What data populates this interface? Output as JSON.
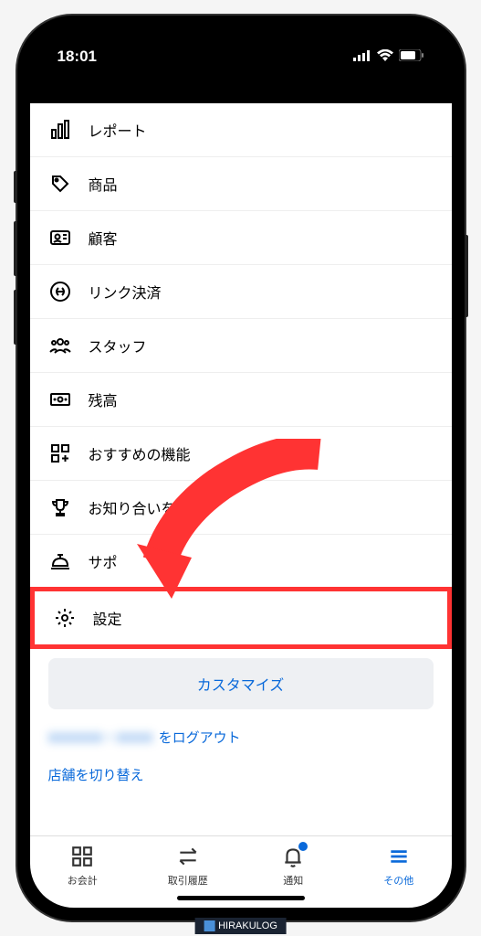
{
  "status_bar": {
    "time": "18:01"
  },
  "menu": {
    "items": [
      {
        "id": "reports",
        "label": "レポート"
      },
      {
        "id": "items",
        "label": "商品"
      },
      {
        "id": "customers",
        "label": "顧客"
      },
      {
        "id": "link-payment",
        "label": "リンク決済"
      },
      {
        "id": "staff",
        "label": "スタッフ"
      },
      {
        "id": "balance",
        "label": "残高"
      },
      {
        "id": "addons",
        "label": "おすすめの機能"
      },
      {
        "id": "referral",
        "label": "お知り合いを"
      },
      {
        "id": "support",
        "label": "サポ"
      },
      {
        "id": "settings",
        "label": "設定"
      }
    ]
  },
  "customize_button": "カスタマイズ",
  "logout": {
    "blurred_prefix": "XXXXXX・XXXX",
    "suffix": "をログアウト"
  },
  "switch_store": "店舗を切り替え",
  "tabs": [
    {
      "id": "checkout",
      "label": "お会計"
    },
    {
      "id": "transactions",
      "label": "取引履歴"
    },
    {
      "id": "notifications",
      "label": "通知",
      "badge": true
    },
    {
      "id": "more",
      "label": "その他",
      "active": true
    }
  ],
  "watermark": "HIRAKULOG",
  "annotation": {
    "highlight_color": "#ff3333",
    "arrow_color": "#ff3333"
  }
}
